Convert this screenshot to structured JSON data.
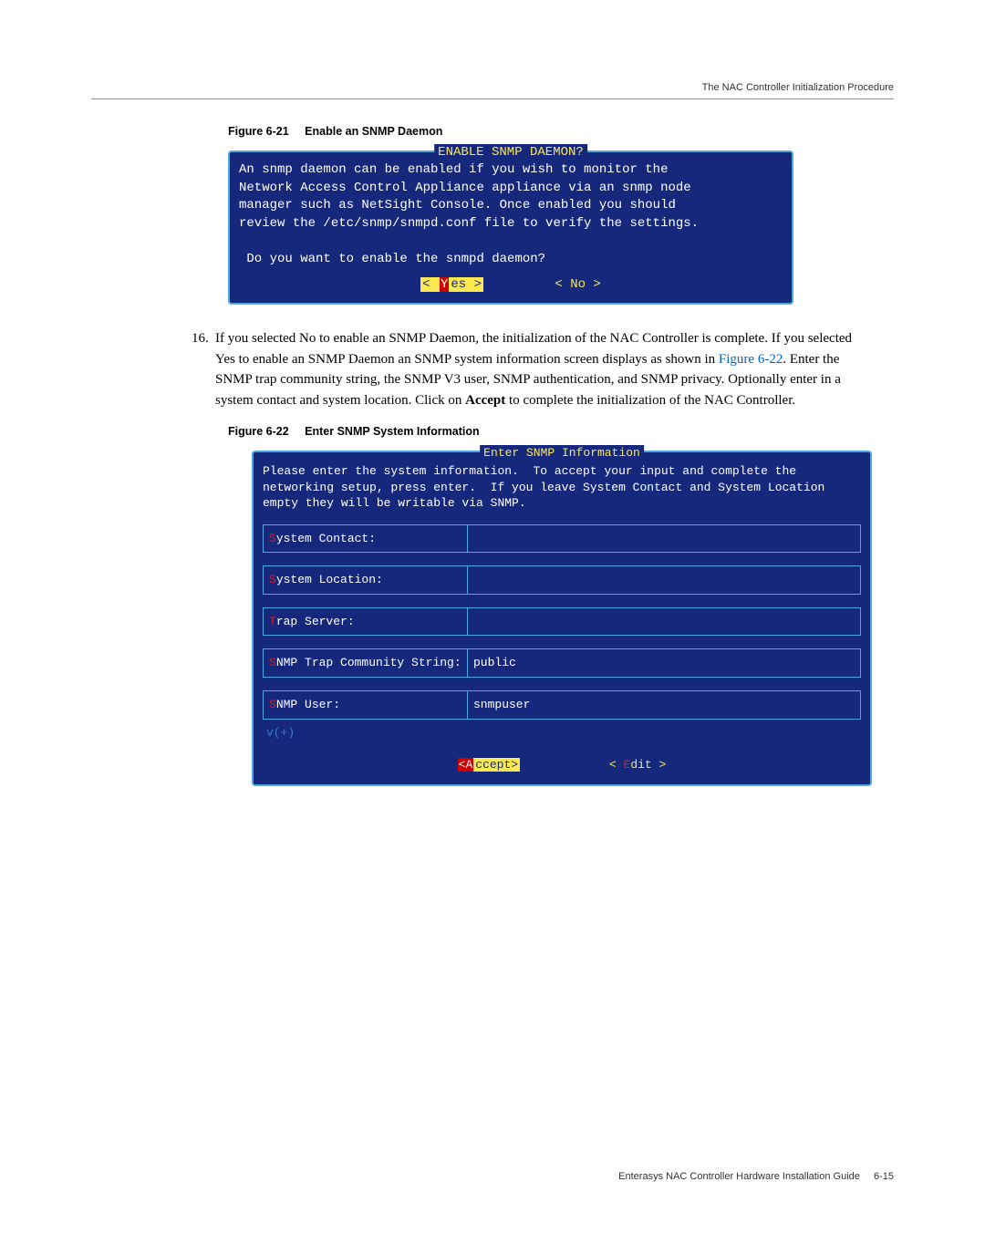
{
  "header": {
    "right_text": "The NAC Controller Initialization Procedure"
  },
  "figure1": {
    "number": "Figure 6-21",
    "title": "Enable an SNMP Daemon",
    "dialog_title": "ENABLE SNMP DAEMON?",
    "body_line1": "An snmp daemon can be enabled if you wish to monitor the",
    "body_line2": "Network Access Control Appliance appliance via an snmp node",
    "body_line3": "manager such as NetSight Console. Once enabled you should",
    "body_line4": "review the /etc/snmp/snmpd.conf file to verify the settings.",
    "question": " Do you want to enable the snmpd daemon?",
    "yes_open": "< ",
    "yes_hot": "Y",
    "yes_rest": "es >",
    "no_label": "< No  >"
  },
  "step": {
    "num": "16.",
    "t1": "If you selected No to enable an SNMP Daemon, the initialization of the NAC Controller is complete. If you selected Yes to enable an SNMP Daemon an SNMP system information screen displays as shown in ",
    "link": "Figure 6-22",
    "t2": ". Enter the SNMP trap community string, the SNMP V3 user, SNMP authentication, and SNMP privacy. Optionally enter in a system contact and system location. Click on ",
    "bold": "Accept",
    "t3": " to complete the initialization of the NAC Controller."
  },
  "figure2": {
    "number": "Figure 6-22",
    "title": "Enter SNMP System Information",
    "dialog_title": "Enter SNMP Information",
    "intro": "Please enter the system information.  To accept your input and complete the networking setup, press enter.  If you leave System Contact and System Location empty they will be writable via SNMP.",
    "fields": {
      "contact_hot": "S",
      "contact_rest": "ystem Contact:",
      "contact_val": "",
      "location_hot": "S",
      "location_rest": "ystem Location:",
      "location_val": "",
      "trap_hot": "T",
      "trap_rest": "rap Server:",
      "trap_val": "",
      "comm_hot": "S",
      "comm_rest": "NMP Trap Community String:",
      "comm_val": "public",
      "user_hot": "S",
      "user_rest": "NMP User:",
      "user_val": "snmpuser"
    },
    "scroll": "v(+)",
    "accept_br": "<A",
    "accept_rest": "ccept>",
    "edit_open": "< ",
    "edit_hot": "E",
    "edit_rest": "dit >"
  },
  "footer": {
    "text": "Enterasys NAC Controller Hardware Installation Guide",
    "page": "6-15"
  }
}
